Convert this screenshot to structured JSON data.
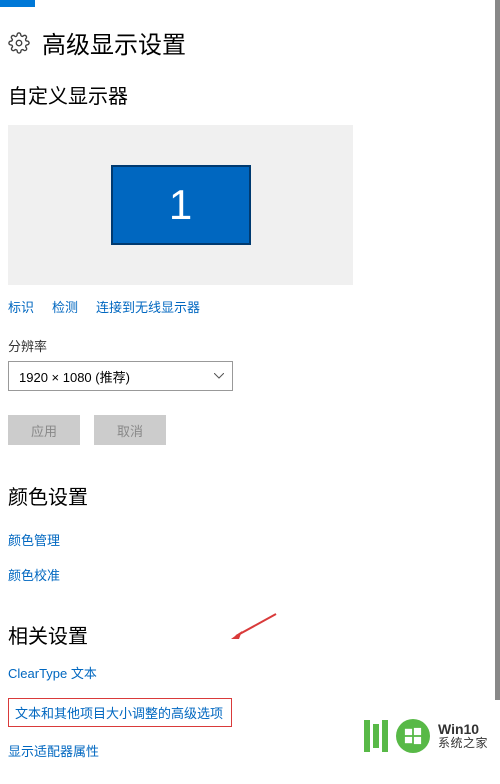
{
  "header": {
    "title": "高级显示设置"
  },
  "custom_display": {
    "title": "自定义显示器",
    "monitor_number": "1",
    "links": {
      "identify": "标识",
      "detect": "检测",
      "wireless": "连接到无线显示器"
    }
  },
  "resolution": {
    "label": "分辨率",
    "value": "1920 × 1080 (推荐)"
  },
  "buttons": {
    "apply": "应用",
    "cancel": "取消"
  },
  "color": {
    "title": "颜色设置",
    "manage": "颜色管理",
    "calibrate": "颜色校准"
  },
  "related": {
    "title": "相关设置",
    "cleartype": "ClearType 文本",
    "text_sizing": "文本和其他项目大小调整的高级选项",
    "adapter": "显示适配器属性"
  },
  "watermark": {
    "line1": "Win10",
    "line2": "系统之家"
  }
}
